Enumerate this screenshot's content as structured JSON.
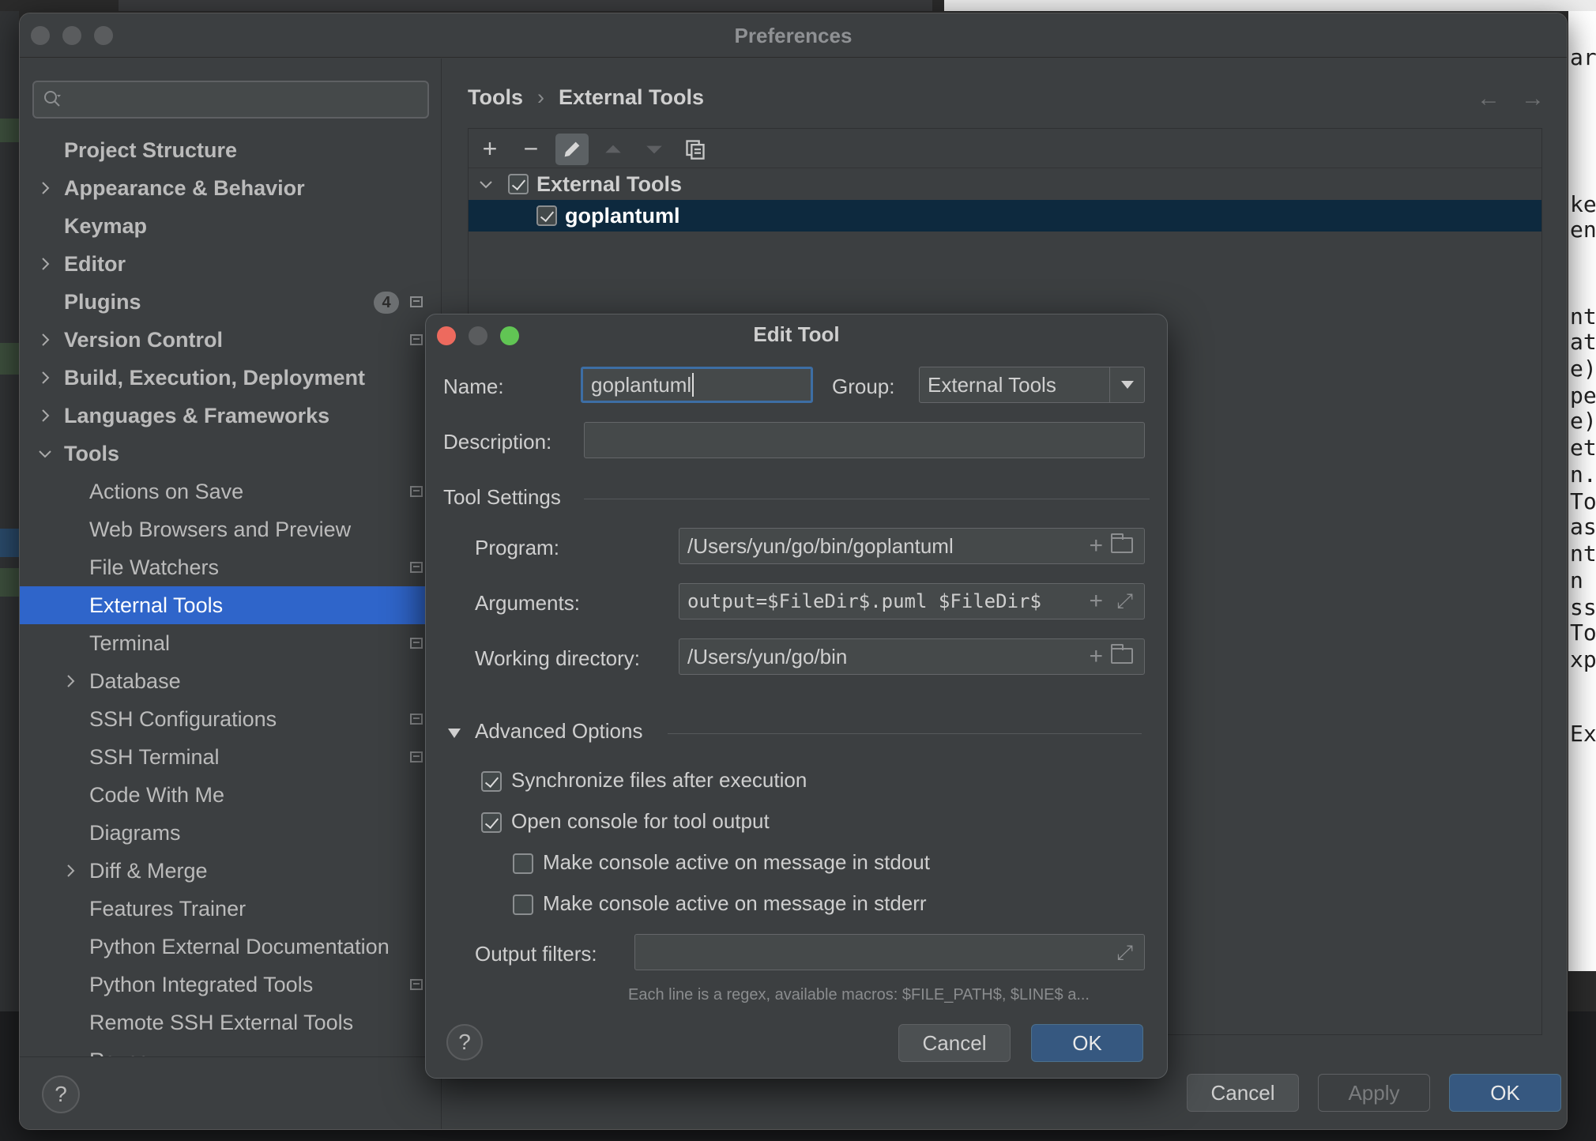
{
  "window": {
    "title": "Preferences"
  },
  "search": {
    "placeholder": ""
  },
  "sidebar": {
    "items": [
      {
        "label": "Project Structure"
      },
      {
        "label": "Appearance & Behavior"
      },
      {
        "label": "Keymap"
      },
      {
        "label": "Editor"
      },
      {
        "label": "Plugins",
        "badge": "4"
      },
      {
        "label": "Version Control"
      },
      {
        "label": "Build, Execution, Deployment"
      },
      {
        "label": "Languages & Frameworks"
      },
      {
        "label": "Tools"
      },
      {
        "label": "Actions on Save"
      },
      {
        "label": "Web Browsers and Preview"
      },
      {
        "label": "File Watchers"
      },
      {
        "label": "External Tools"
      },
      {
        "label": "Terminal"
      },
      {
        "label": "Database"
      },
      {
        "label": "SSH Configurations"
      },
      {
        "label": "SSH Terminal"
      },
      {
        "label": "Code With Me"
      },
      {
        "label": "Diagrams"
      },
      {
        "label": "Diff & Merge"
      },
      {
        "label": "Features Trainer"
      },
      {
        "label": "Python External Documentation"
      },
      {
        "label": "Python Integrated Tools"
      },
      {
        "label": "Remote SSH External Tools"
      },
      {
        "label": "Rsync"
      }
    ],
    "help_label": "?"
  },
  "breadcrumb": {
    "root": "Tools",
    "sep": "›",
    "current": "External Tools"
  },
  "nav": {
    "back": "←",
    "forward": "→"
  },
  "toolbar": {
    "add": "+",
    "remove": "−"
  },
  "tools_tree": {
    "group_label": "External Tools",
    "item_label": "goplantuml"
  },
  "main_buttons": {
    "cancel": "Cancel",
    "apply": "Apply",
    "ok": "OK"
  },
  "colors": {
    "accent": "#2f65ca",
    "close": "#ed6a5e",
    "minimize": "#5a5c5e",
    "zoom": "#61c554"
  },
  "dialog": {
    "title": "Edit Tool",
    "name_label": "Name:",
    "name_value": "goplantuml",
    "group_label": "Group:",
    "group_value": "External Tools",
    "description_label": "Description:",
    "description_value": "",
    "tool_settings_label": "Tool Settings",
    "program_label": "Program:",
    "program_value": "/Users/yun/go/bin/goplantuml",
    "arguments_label": "Arguments:",
    "arguments_value": "output=$FileDir$.puml $FileDir$",
    "working_dir_label": "Working directory:",
    "working_dir_value": "/Users/yun/go/bin",
    "advanced_label": "Advanced Options",
    "sync_label": "Synchronize files after execution",
    "open_console_label": "Open console for tool output",
    "stdout_label": "Make console active on message in stdout",
    "stderr_label": "Make console active on message in stderr",
    "output_filters_label": "Output filters:",
    "output_filters_value": "",
    "hint": "Each line is a regex, available macros: $FILE_PATH$, $LINE$ a...",
    "cancel": "Cancel",
    "ok": "OK",
    "help": "?",
    "plus": "+",
    "expand": "⤢"
  },
  "bg_right_text": [
    "ars",
    "ker",
    "enT",
    "nt",
    "ate",
    "e) b",
    "pe)",
    "e) I",
    "etu",
    "n.T",
    "To",
    "ast",
    "nt)",
    "n",
    "ss",
    "To",
    "xpr",
    "Exp"
  ]
}
